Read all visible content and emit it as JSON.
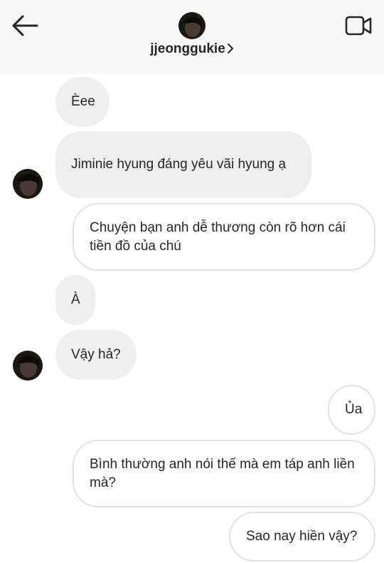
{
  "header": {
    "username": "jjeonggukie",
    "back_icon": "arrow-left-icon",
    "video_icon": "video-camera-icon",
    "chevron_icon": "chevron-right-icon"
  },
  "messages": [
    {
      "from": "them",
      "text": "Èee"
    },
    {
      "from": "them",
      "text": "Jiminie hyung đáng yêu vãi hyung ạ"
    },
    {
      "from": "me",
      "text": "Chuyện bạn anh dễ thương còn rõ hơn cái tiền đồ của chú"
    },
    {
      "from": "them",
      "text": "À"
    },
    {
      "from": "them",
      "text": "Vậy hả?"
    },
    {
      "from": "me",
      "text": "Ủa"
    },
    {
      "from": "me",
      "text": "Bình thường anh nói thế mà em táp anh liền mà?"
    },
    {
      "from": "me",
      "text": "Sao nay hiền vậy?"
    }
  ]
}
